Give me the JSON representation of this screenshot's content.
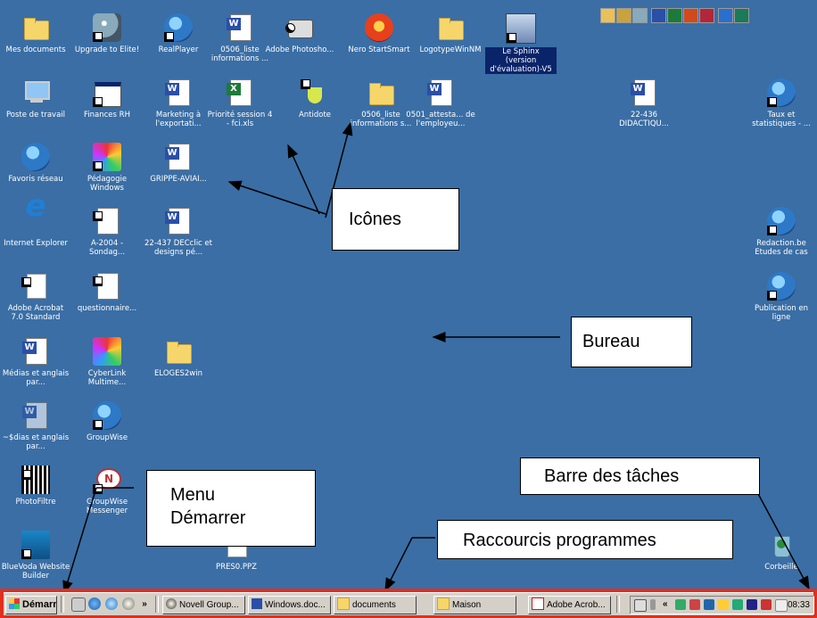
{
  "desktop": {
    "background": "#3a6ea5",
    "icons": [
      {
        "label": "Mes documents",
        "icon": "folder-docs"
      },
      {
        "label": "Upgrade to Elite!",
        "icon": "tower-shortcut"
      },
      {
        "label": "RealPlayer",
        "icon": "realplayer"
      },
      {
        "label": "0506_liste informations ...",
        "icon": "word-doc"
      },
      {
        "label": "Adobe Photosho...",
        "icon": "camera"
      },
      {
        "label": "Nero StartSmart",
        "icon": "nero"
      },
      {
        "label": "LogotypeWinNM",
        "icon": "folder"
      },
      {
        "label": "Le Sphinx (version d'évaluation)-V5",
        "icon": "sphinx"
      },
      {
        "label": "Poste de travail",
        "icon": "computer"
      },
      {
        "label": "Finances RH",
        "icon": "window"
      },
      {
        "label": "Marketing à l'exportati...",
        "icon": "word-doc"
      },
      {
        "label": "Priorité session 4 - fci.xls",
        "icon": "excel-doc"
      },
      {
        "label": "Antidote",
        "icon": "flask"
      },
      {
        "label": "0506_liste informations s...",
        "icon": "folder"
      },
      {
        "label": "0501_attesta... de l'employeu...",
        "icon": "word-doc"
      },
      {
        "label": "22-436 DIDACTIQU...",
        "icon": "word-doc"
      },
      {
        "label": "Taux et statistiques - ...",
        "icon": "ie-doc"
      },
      {
        "label": "Favoris réseau",
        "icon": "network"
      },
      {
        "label": "Pédagogie Windows",
        "icon": "colorful"
      },
      {
        "label": "GRIPPE-AVIAI...",
        "icon": "word-doc"
      },
      {
        "label": "Internet Explorer",
        "icon": "ie"
      },
      {
        "label": "A-2004 - Sondag...",
        "icon": "word-doc"
      },
      {
        "label": "22-437 DECclic et designs pé...",
        "icon": "word-doc"
      },
      {
        "label": "Redaction.be Etudes de cas",
        "icon": "ie-doc"
      },
      {
        "label": "Adobe Acrobat 7.0 Standard",
        "icon": "pdf"
      },
      {
        "label": "questionnaire...",
        "icon": "word-doc"
      },
      {
        "label": "Publication en ligne",
        "icon": "ie-doc"
      },
      {
        "label": "Médias et anglais par...",
        "icon": "word-doc"
      },
      {
        "label": "CyberLink Multime...",
        "icon": "colorful"
      },
      {
        "label": "ELOGES2win",
        "icon": "folder"
      },
      {
        "label": "~$dias et anglais par...",
        "icon": "word-doc"
      },
      {
        "label": "GroupWise",
        "icon": "globe"
      },
      {
        "label": "PhotoFiltre",
        "icon": "film"
      },
      {
        "label": "GroupWise Messenger",
        "icon": "bubble"
      },
      {
        "label": "BlueVoda Website Builder",
        "icon": "bv"
      },
      {
        "label": "PRES0.PPZ",
        "icon": "ppz"
      },
      {
        "label": "Corbeille",
        "icon": "trash"
      }
    ]
  },
  "annotations": {
    "icones": "Icônes",
    "bureau": "Bureau",
    "barre": "Barre des tâches",
    "menu_line1": "Menu",
    "menu_line2": "Démarrer",
    "raccourcis": "Raccourcis programmes"
  },
  "taskbar": {
    "start_label": "Démarrer",
    "quicklaunch_more": "»",
    "tasks": [
      {
        "label": "Novell Group..."
      },
      {
        "label": "Windows.doc..."
      },
      {
        "label": "documents"
      },
      {
        "label": "Maison"
      },
      {
        "label": "Adobe Acrob..."
      }
    ],
    "tray_more": "«",
    "clock": "08:33",
    "frame_color": "#e0301e"
  }
}
